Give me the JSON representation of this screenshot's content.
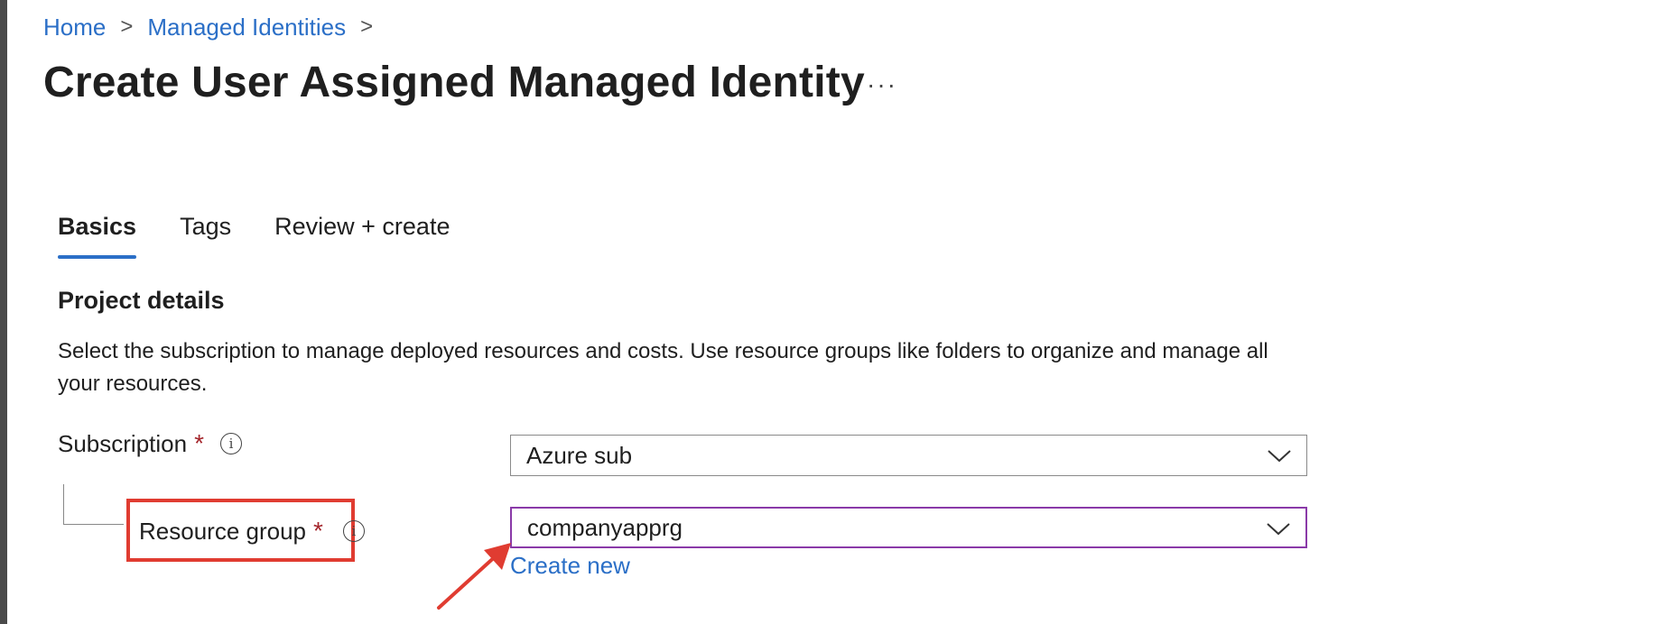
{
  "breadcrumb": {
    "items": [
      "Home",
      "Managed Identities"
    ],
    "separator": ">"
  },
  "page": {
    "title": "Create User Assigned Managed Identity",
    "more_label": "···"
  },
  "tabs": [
    {
      "label": "Basics",
      "active": true
    },
    {
      "label": "Tags",
      "active": false
    },
    {
      "label": "Review + create",
      "active": false
    }
  ],
  "project_details": {
    "title": "Project details",
    "description": "Select the subscription to manage deployed resources and costs. Use resource groups like folders to organize and manage all your resources."
  },
  "fields": {
    "subscription": {
      "label": "Subscription",
      "required": "*",
      "value": "Azure sub"
    },
    "resource_group": {
      "label": "Resource group",
      "required": "*",
      "value": "companyapprg",
      "create_new_label": "Create new"
    }
  },
  "icons": {
    "info": "info-icon",
    "chevron": "chevron-down-icon",
    "annotation": "red-arrow-icon"
  },
  "colors": {
    "link": "#2b6fc7",
    "required": "#a4262c",
    "annotation": "#e03c31",
    "focus_border": "#8a3aa8"
  }
}
